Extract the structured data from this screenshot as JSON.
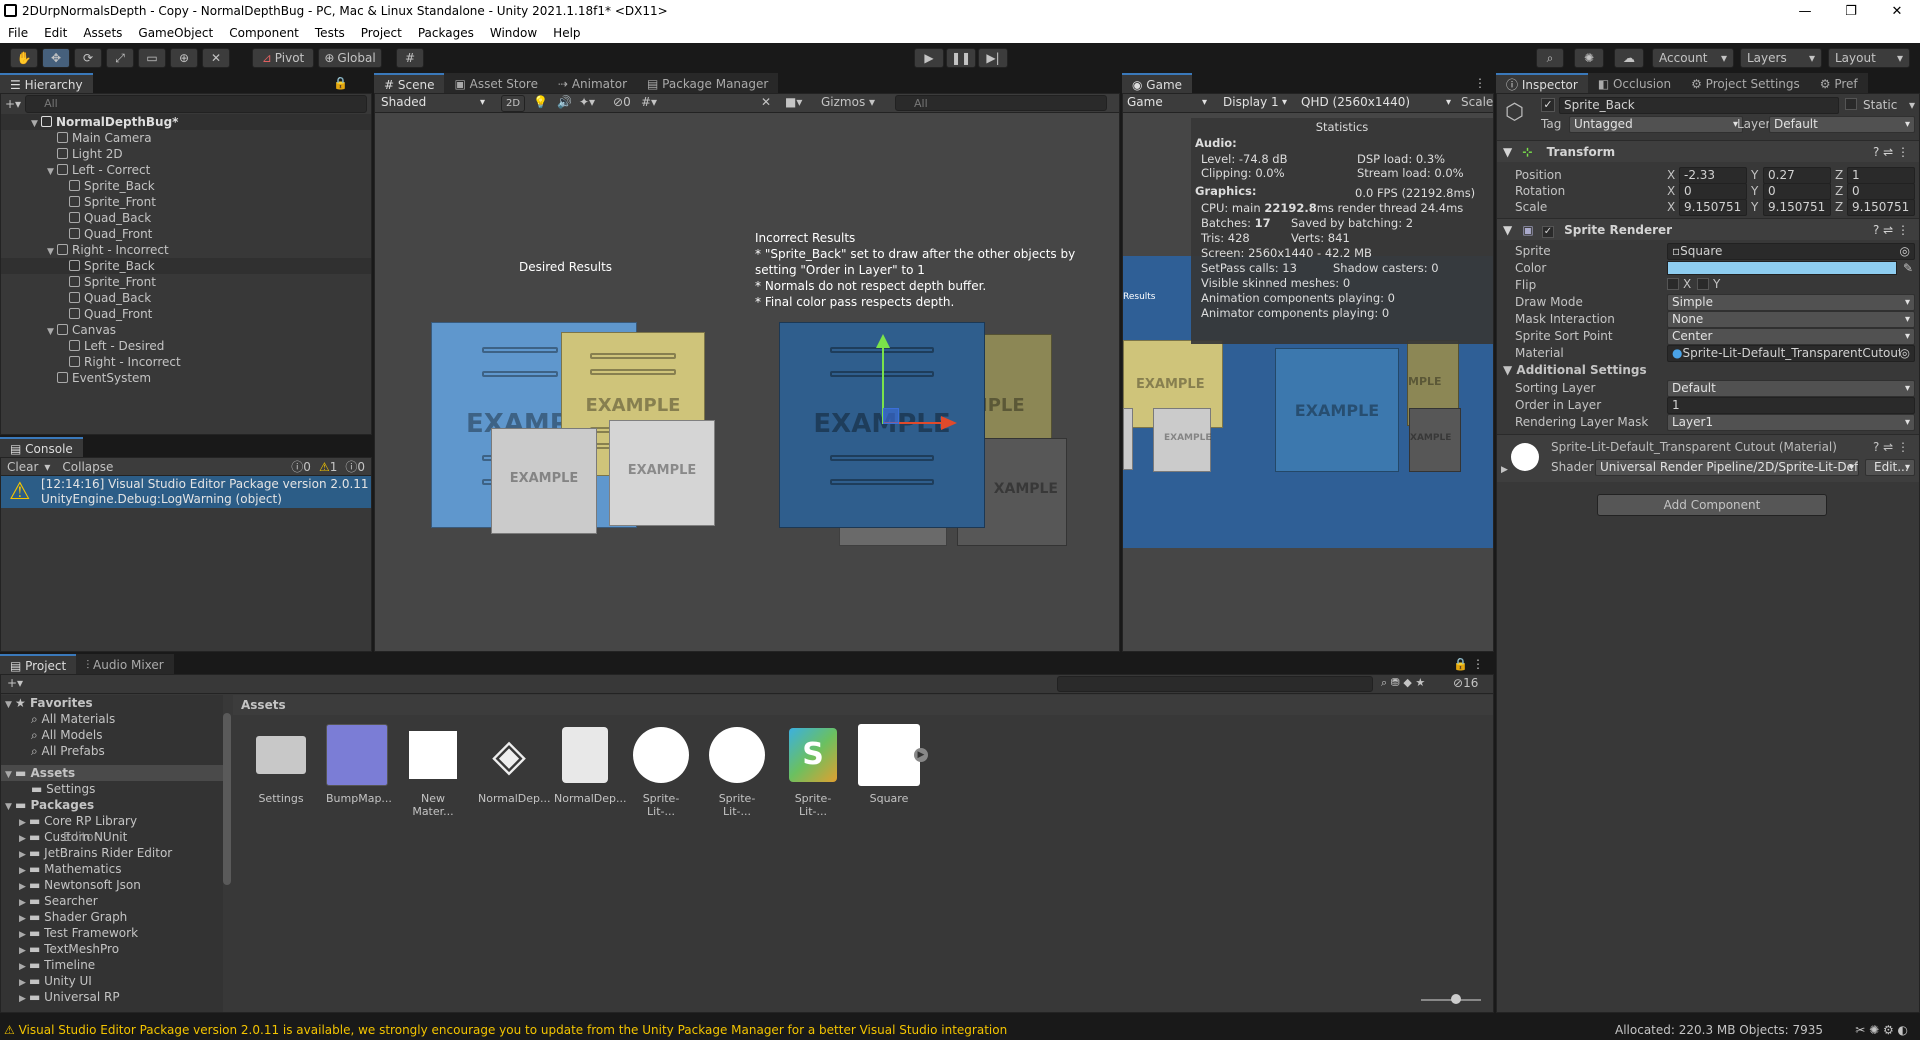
{
  "window": {
    "title": "2DUrpNormalsDepth - Copy - NormalDepthBug - PC, Mac & Linux Standalone - Unity 2021.1.18f1* <DX11>",
    "minimize": "—",
    "maximize": "❐",
    "close": "✕"
  },
  "menu": [
    "File",
    "Edit",
    "Assets",
    "GameObject",
    "Component",
    "Tests",
    "Project",
    "Packages",
    "Window",
    "Help"
  ],
  "toolbar": {
    "pivot": "Pivot",
    "global": "Global",
    "account": "Account",
    "layers": "Layers",
    "layout": "Layout"
  },
  "hierarchy": {
    "tab": "Hierarchy",
    "search_placeholder": "All",
    "root": "NormalDepthBug*",
    "items": [
      {
        "label": "Main Camera",
        "depth": 1,
        "arrow": ""
      },
      {
        "label": "Light 2D",
        "depth": 1,
        "arrow": ""
      },
      {
        "label": "Left - Correct",
        "depth": 1,
        "arrow": "▼"
      },
      {
        "label": "Sprite_Back",
        "depth": 2,
        "arrow": ""
      },
      {
        "label": "Sprite_Front",
        "depth": 2,
        "arrow": ""
      },
      {
        "label": "Quad_Back",
        "depth": 2,
        "arrow": ""
      },
      {
        "label": "Quad_Front",
        "depth": 2,
        "arrow": ""
      },
      {
        "label": "Right - Incorrect",
        "depth": 1,
        "arrow": "▼"
      },
      {
        "label": "Sprite_Back",
        "depth": 2,
        "arrow": "",
        "selected": true
      },
      {
        "label": "Sprite_Front",
        "depth": 2,
        "arrow": ""
      },
      {
        "label": "Quad_Back",
        "depth": 2,
        "arrow": ""
      },
      {
        "label": "Quad_Front",
        "depth": 2,
        "arrow": ""
      },
      {
        "label": "Canvas",
        "depth": 1,
        "arrow": "▼"
      },
      {
        "label": "Left - Desired",
        "depth": 2,
        "arrow": ""
      },
      {
        "label": "Right - Incorrect",
        "depth": 2,
        "arrow": ""
      },
      {
        "label": "EventSystem",
        "depth": 1,
        "arrow": ""
      }
    ]
  },
  "console": {
    "tab": "Console",
    "clear": "Clear",
    "collapse": "Collapse",
    "count_info": "0",
    "count_warn": "1",
    "count_err": "0",
    "line1": "[12:14:16] Visual Studio Editor Package version 2.0.11 is ava",
    "line2": "UnityEngine.Debug:LogWarning (object)"
  },
  "scene": {
    "tabs": [
      "Scene",
      "Asset Store",
      "Animator",
      "Package Manager"
    ],
    "shading": "Shaded",
    "mode2d": "2D",
    "gizmos": "Gizmos",
    "search_placeholder": "All",
    "hidden_count": "0",
    "desired": "Desired Results",
    "incorrect_title": "Incorrect Results",
    "incorrect_lines": [
      "* \"Sprite_Back\" set to draw after the other objects by",
      "setting \"Order in Layer\" to 1",
      "* Normals do not respect depth buffer.",
      "* Final color pass respects depth."
    ],
    "example": "EXAMPLE",
    "example_short": "EXAMP",
    "example_cut": "IPLE",
    "example_cut2": "XAMPLE"
  },
  "game": {
    "tab": "Game",
    "display_mode": "Game",
    "display": "Display 1",
    "resolution": "QHD (2560x1440)",
    "scale": "Scale",
    "results_cut": "Results",
    "example": "EXAMPLE",
    "example_cut": "MPLE",
    "example_cut3": "XAMPLE",
    "stats": {
      "title": "Statistics",
      "audio": "Audio:",
      "level": "Level: -74.8 dB",
      "dsp": "DSP load: 0.3%",
      "clipping": "Clipping: 0.0%",
      "stream": "Stream load: 0.0%",
      "graphics": "Graphics:",
      "fps": "0.0 FPS (22192.8ms)",
      "cpu_pre": "CPU: main ",
      "cpu_bold": "22192.8",
      "cpu_post": "ms  render thread 24.4ms",
      "batches_pre": "Batches: ",
      "batches_bold": "17",
      "saved": "Saved by batching: 2",
      "tris": "Tris: 428",
      "verts": "Verts: 841",
      "screen": "Screen: 2560x1440 - 42.2 MB",
      "setpass": "SetPass calls: 13",
      "shadow": "Shadow casters: 0",
      "skinned": "Visible skinned meshes: 0",
      "anim": "Animation components playing: 0",
      "animator": "Animator components playing: 0"
    }
  },
  "inspector": {
    "tabs": [
      "Inspector",
      "Occlusion",
      "Project Settings",
      "Pref"
    ],
    "name": "Sprite_Back",
    "static": "Static",
    "tag_label": "Tag",
    "tag": "Untagged",
    "layer_label": "Layer",
    "layer": "Default",
    "transform": {
      "title": "Transform",
      "position": "Position",
      "rotation": "Rotation",
      "scale": "Scale",
      "px": "-2.33",
      "py": "0.27",
      "pz": "1",
      "rx": "0",
      "ry": "0",
      "rz": "0",
      "sx": "9.150751",
      "sy": "9.150751",
      "sz": "9.150751",
      "x": "X",
      "y": "Y",
      "z": "Z"
    },
    "sr": {
      "title": "Sprite Renderer",
      "sprite_l": "Sprite",
      "sprite": "Square",
      "color_l": "Color",
      "color": "#8ecdf0",
      "flip_l": "Flip",
      "flip_x": "X",
      "flip_y": "Y",
      "drawmode_l": "Draw Mode",
      "drawmode": "Simple",
      "mask_l": "Mask Interaction",
      "mask": "None",
      "sort_l": "Sprite Sort Point",
      "sort": "Center",
      "material_l": "Material",
      "material": "Sprite-Lit-Default_TransparentCutout",
      "additional": "Additional Settings",
      "sorting_l": "Sorting Layer",
      "sorting": "Default",
      "order_l": "Order in Layer",
      "order": "1",
      "rlm_l": "Rendering Layer Mask",
      "rlm": "Layer1"
    },
    "mat": {
      "name": "Sprite-Lit-Default_Transparent Cutout (Material)",
      "shader_l": "Shader",
      "shader": "Universal Render Pipeline/2D/Sprite-Lit-Defa",
      "edit": "Edit..."
    },
    "add_component": "Add Component"
  },
  "project": {
    "tabs": [
      "Project",
      "Audio Mixer"
    ],
    "favorites": "Favorites",
    "fav_items": [
      "All Materials",
      "All Models",
      "All Prefabs"
    ],
    "assets": "Assets",
    "settings": "Settings",
    "packages": "Packages",
    "pkg_items": [
      "Core RP Library",
      "Custom NUnit",
      "JetBrains Rider Editor",
      "Mathematics",
      "Newtonsoft Json",
      "Searcher",
      "Shader Graph",
      "Test Framework",
      "TextMeshPro",
      "Timeline",
      "Unity UI",
      "Universal RP"
    ],
    "pkg_cut": "Editor",
    "breadcrumb": "Assets",
    "hidden": "16",
    "files": [
      "Settings",
      "BumpMap...",
      "New Mater...",
      "NormalDep...",
      "NormalDep...",
      "Sprite-Lit-...",
      "Sprite-Lit-...",
      "Sprite-Lit-...",
      "Square"
    ]
  },
  "status": {
    "message": "Visual Studio Editor Package version 2.0.11 is available, we strongly encourage you to update from the Unity Package Manager for a better Visual Studio integration",
    "memory": "Allocated: 220.3 MB Objects: 7935"
  }
}
